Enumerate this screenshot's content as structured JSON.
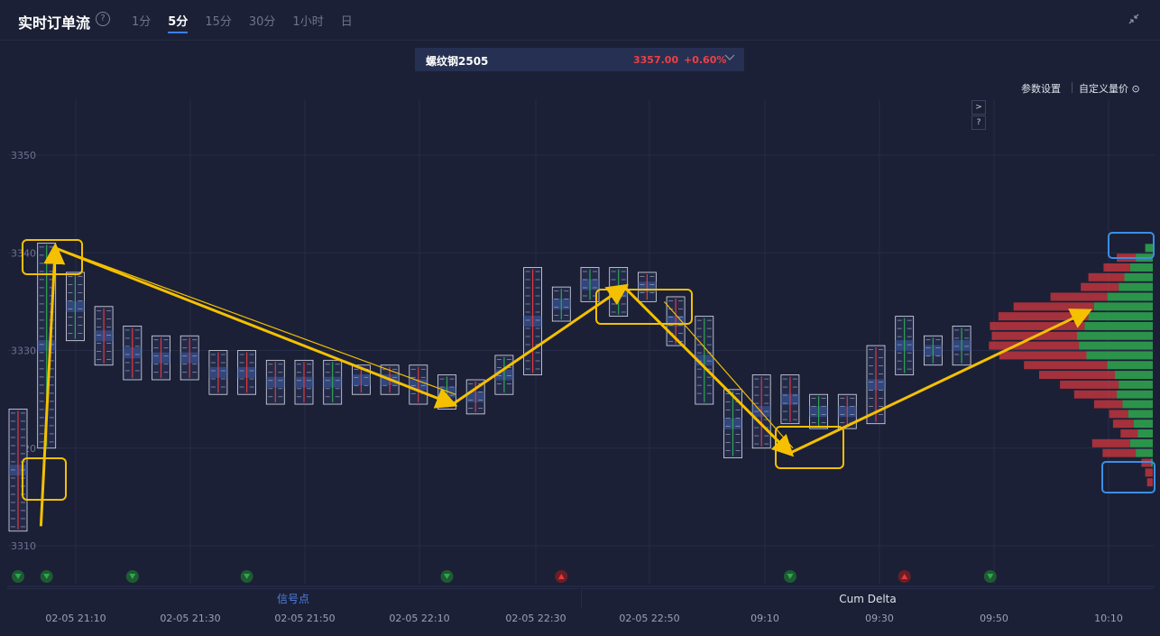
{
  "header": {
    "title": "实时订单流",
    "help_icon": "?",
    "tabs": [
      "1分",
      "5分",
      "15分",
      "30分",
      "1小时",
      "日"
    ],
    "active_tab": "5分"
  },
  "symbol": {
    "name": "螺纹钢2505",
    "price": "3357.00",
    "change": "+0.60%"
  },
  "toolbar": {
    "settings_label": "参数设置",
    "custom_label": "自定义量价 ⊙",
    "expand_btn": ">",
    "help_btn": "?"
  },
  "bottom_tabs": {
    "signals": "信号点",
    "cum_delta": "Cum Delta"
  },
  "colors": {
    "background": "#1b2036",
    "up": "#2fa84f",
    "down": "#e0393e",
    "annotation": "#f5c000",
    "highlight_box_blue": "#3a8fe6",
    "active_tab_underline": "#3d7ef2"
  },
  "chart_data": {
    "type": "footprint",
    "y_ticks": [
      "3350",
      "3340",
      "3330",
      "3320",
      "3310"
    ],
    "y_tick_values": [
      3350,
      3340,
      3330,
      3320,
      3310
    ],
    "ylim": [
      3305,
      3355
    ],
    "x_ticks": [
      "02-05 21:10",
      "02-05 21:30",
      "02-05 21:50",
      "02-05 22:10",
      "02-05 22:30",
      "02-05 22:50",
      "09:10",
      "09:30",
      "09:50",
      "10:10"
    ],
    "candles": [
      {
        "x": 0,
        "low": 3311.5,
        "high": 3324,
        "dir": "down"
      },
      {
        "x": 1,
        "low": 3320,
        "high": 3341,
        "dir": "up"
      },
      {
        "x": 2,
        "low": 3331,
        "high": 3338,
        "dir": "up"
      },
      {
        "x": 3,
        "low": 3328.5,
        "high": 3334.5,
        "dir": "down"
      },
      {
        "x": 4,
        "low": 3327,
        "high": 3332.5,
        "dir": "down"
      },
      {
        "x": 5,
        "low": 3327,
        "high": 3331.5,
        "dir": "down"
      },
      {
        "x": 6,
        "low": 3327,
        "high": 3331.5,
        "dir": "down"
      },
      {
        "x": 7,
        "low": 3325.5,
        "high": 3330,
        "dir": "down"
      },
      {
        "x": 8,
        "low": 3325.5,
        "high": 3330,
        "dir": "down"
      },
      {
        "x": 9,
        "low": 3324.5,
        "high": 3329,
        "dir": "down"
      },
      {
        "x": 10,
        "low": 3324.5,
        "high": 3329,
        "dir": "down"
      },
      {
        "x": 11,
        "low": 3324.5,
        "high": 3329,
        "dir": "up"
      },
      {
        "x": 12,
        "low": 3325.5,
        "high": 3328.5,
        "dir": "down"
      },
      {
        "x": 13,
        "low": 3325.5,
        "high": 3328.5,
        "dir": "down"
      },
      {
        "x": 14,
        "low": 3324.5,
        "high": 3328.5,
        "dir": "down"
      },
      {
        "x": 15,
        "low": 3324,
        "high": 3327.5,
        "dir": "up"
      },
      {
        "x": 16,
        "low": 3323.5,
        "high": 3327,
        "dir": "down"
      },
      {
        "x": 17,
        "low": 3325.5,
        "high": 3329.5,
        "dir": "up"
      },
      {
        "x": 18,
        "low": 3327.5,
        "high": 3338.5,
        "dir": "down"
      },
      {
        "x": 19,
        "low": 3333,
        "high": 3336.5,
        "dir": "up"
      },
      {
        "x": 20,
        "low": 3335,
        "high": 3338.5,
        "dir": "up"
      },
      {
        "x": 21,
        "low": 3333.5,
        "high": 3338.5,
        "dir": "up"
      },
      {
        "x": 22,
        "low": 3335,
        "high": 3338,
        "dir": "down"
      },
      {
        "x": 23,
        "low": 3330.5,
        "high": 3335.5,
        "dir": "down"
      },
      {
        "x": 24,
        "low": 3324.5,
        "high": 3333.5,
        "dir": "up"
      },
      {
        "x": 25,
        "low": 3319,
        "high": 3326,
        "dir": "up"
      },
      {
        "x": 26,
        "low": 3320,
        "high": 3327.5,
        "dir": "down"
      },
      {
        "x": 27,
        "low": 3322.5,
        "high": 3327.5,
        "dir": "down"
      },
      {
        "x": 28,
        "low": 3322,
        "high": 3325.5,
        "dir": "up"
      },
      {
        "x": 29,
        "low": 3322,
        "high": 3325.5,
        "dir": "down"
      },
      {
        "x": 30,
        "low": 3322.5,
        "high": 3330.5,
        "dir": "down"
      },
      {
        "x": 31,
        "low": 3327.5,
        "high": 3333.5,
        "dir": "up"
      },
      {
        "x": 32,
        "low": 3328.5,
        "high": 3331.5,
        "dir": "up"
      },
      {
        "x": 33,
        "low": 3328.5,
        "high": 3332.5,
        "dir": "up"
      }
    ],
    "volume_profile": [
      {
        "price": 3340.5,
        "sell": 0,
        "buy": 8
      },
      {
        "price": 3339.5,
        "sell": 20,
        "buy": 18
      },
      {
        "price": 3338.5,
        "sell": 28,
        "buy": 24
      },
      {
        "price": 3337.5,
        "sell": 38,
        "buy": 30
      },
      {
        "price": 3336.5,
        "sell": 40,
        "buy": 36
      },
      {
        "price": 3335.5,
        "sell": 60,
        "buy": 48
      },
      {
        "price": 3334.5,
        "sell": 85,
        "buy": 62
      },
      {
        "price": 3333.5,
        "sell": 95,
        "buy": 68
      },
      {
        "price": 3332.5,
        "sell": 100,
        "buy": 72
      },
      {
        "price": 3331.5,
        "sell": 90,
        "buy": 80
      },
      {
        "price": 3330.5,
        "sell": 95,
        "buy": 78
      },
      {
        "price": 3329.5,
        "sell": 92,
        "buy": 70
      },
      {
        "price": 3328.5,
        "sell": 88,
        "buy": 48
      },
      {
        "price": 3327.5,
        "sell": 80,
        "buy": 40
      },
      {
        "price": 3326.5,
        "sell": 62,
        "buy": 36
      },
      {
        "price": 3325.5,
        "sell": 45,
        "buy": 38
      },
      {
        "price": 3324.5,
        "sell": 30,
        "buy": 32
      },
      {
        "price": 3323.5,
        "sell": 20,
        "buy": 26
      },
      {
        "price": 3322.5,
        "sell": 22,
        "buy": 20
      },
      {
        "price": 3321.5,
        "sell": 18,
        "buy": 16
      },
      {
        "price": 3320.5,
        "sell": 40,
        "buy": 24
      },
      {
        "price": 3319.5,
        "sell": 35,
        "buy": 18
      },
      {
        "price": 3318.5,
        "sell": 10,
        "buy": 2
      },
      {
        "price": 3317.5,
        "sell": 8,
        "buy": 0
      },
      {
        "price": 3316.5,
        "sell": 6,
        "buy": 0
      }
    ],
    "signals": [
      {
        "candle": 0,
        "dir": "down"
      },
      {
        "candle": 1,
        "dir": "down"
      },
      {
        "candle": 4,
        "dir": "down"
      },
      {
        "candle": 8,
        "dir": "down"
      },
      {
        "candle": 15,
        "dir": "down"
      },
      {
        "candle": 19,
        "dir": "up"
      },
      {
        "candle": 27,
        "dir": "down"
      },
      {
        "candle": 31,
        "dir": "up"
      },
      {
        "candle": 34,
        "dir": "down"
      }
    ],
    "annotation_path": [
      [
        0.8,
        3312
      ],
      [
        1.3,
        3340.5
      ],
      [
        15.2,
        3324.5
      ],
      [
        21.2,
        3336.5
      ],
      [
        27,
        3319.5
      ],
      [
        37.4,
        3334
      ]
    ]
  }
}
